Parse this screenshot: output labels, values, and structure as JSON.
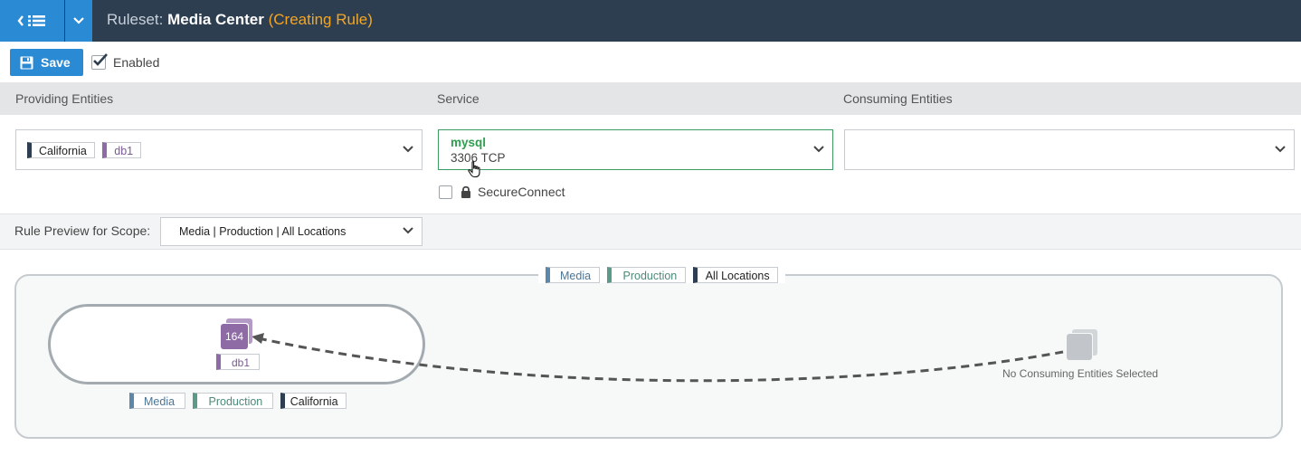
{
  "header": {
    "title_label": "Ruleset:",
    "title_name": "Media Center",
    "title_state": "(Creating Rule)"
  },
  "toolbar": {
    "save_label": "Save",
    "enabled_label": "Enabled",
    "enabled_checked": true
  },
  "columns": {
    "providing": "Providing Entities",
    "service": "Service",
    "consuming": "Consuming Entities"
  },
  "providing": {
    "tags": [
      {
        "label": "California",
        "kind": "location"
      },
      {
        "label": "db1",
        "kind": "app"
      }
    ]
  },
  "service": {
    "name": "mysql",
    "port": "3306 TCP",
    "secure_label": "SecureConnect",
    "secure_checked": false
  },
  "consuming": {
    "tags": []
  },
  "scope": {
    "label": "Rule Preview for Scope:",
    "value": "Media | Production | All Locations"
  },
  "preview": {
    "scope_tags": [
      {
        "label": "Media",
        "kind": "media"
      },
      {
        "label": "Production",
        "kind": "env"
      },
      {
        "label": "All Locations",
        "kind": "location"
      }
    ],
    "provider_count": "164",
    "provider_app": "db1",
    "provider_tags": [
      {
        "label": "Media",
        "kind": "media"
      },
      {
        "label": "Production",
        "kind": "env"
      },
      {
        "label": "California",
        "kind": "location"
      }
    ],
    "consumer_text": "No Consuming Entities Selected"
  },
  "colors": {
    "topbar": "#2d3e50",
    "accent": "#2a8ad4",
    "state": "#f5a623",
    "service_name": "#2e9e4f",
    "app": "#8e6ba5",
    "env": "#5b9a88",
    "media": "#5d87a8"
  }
}
